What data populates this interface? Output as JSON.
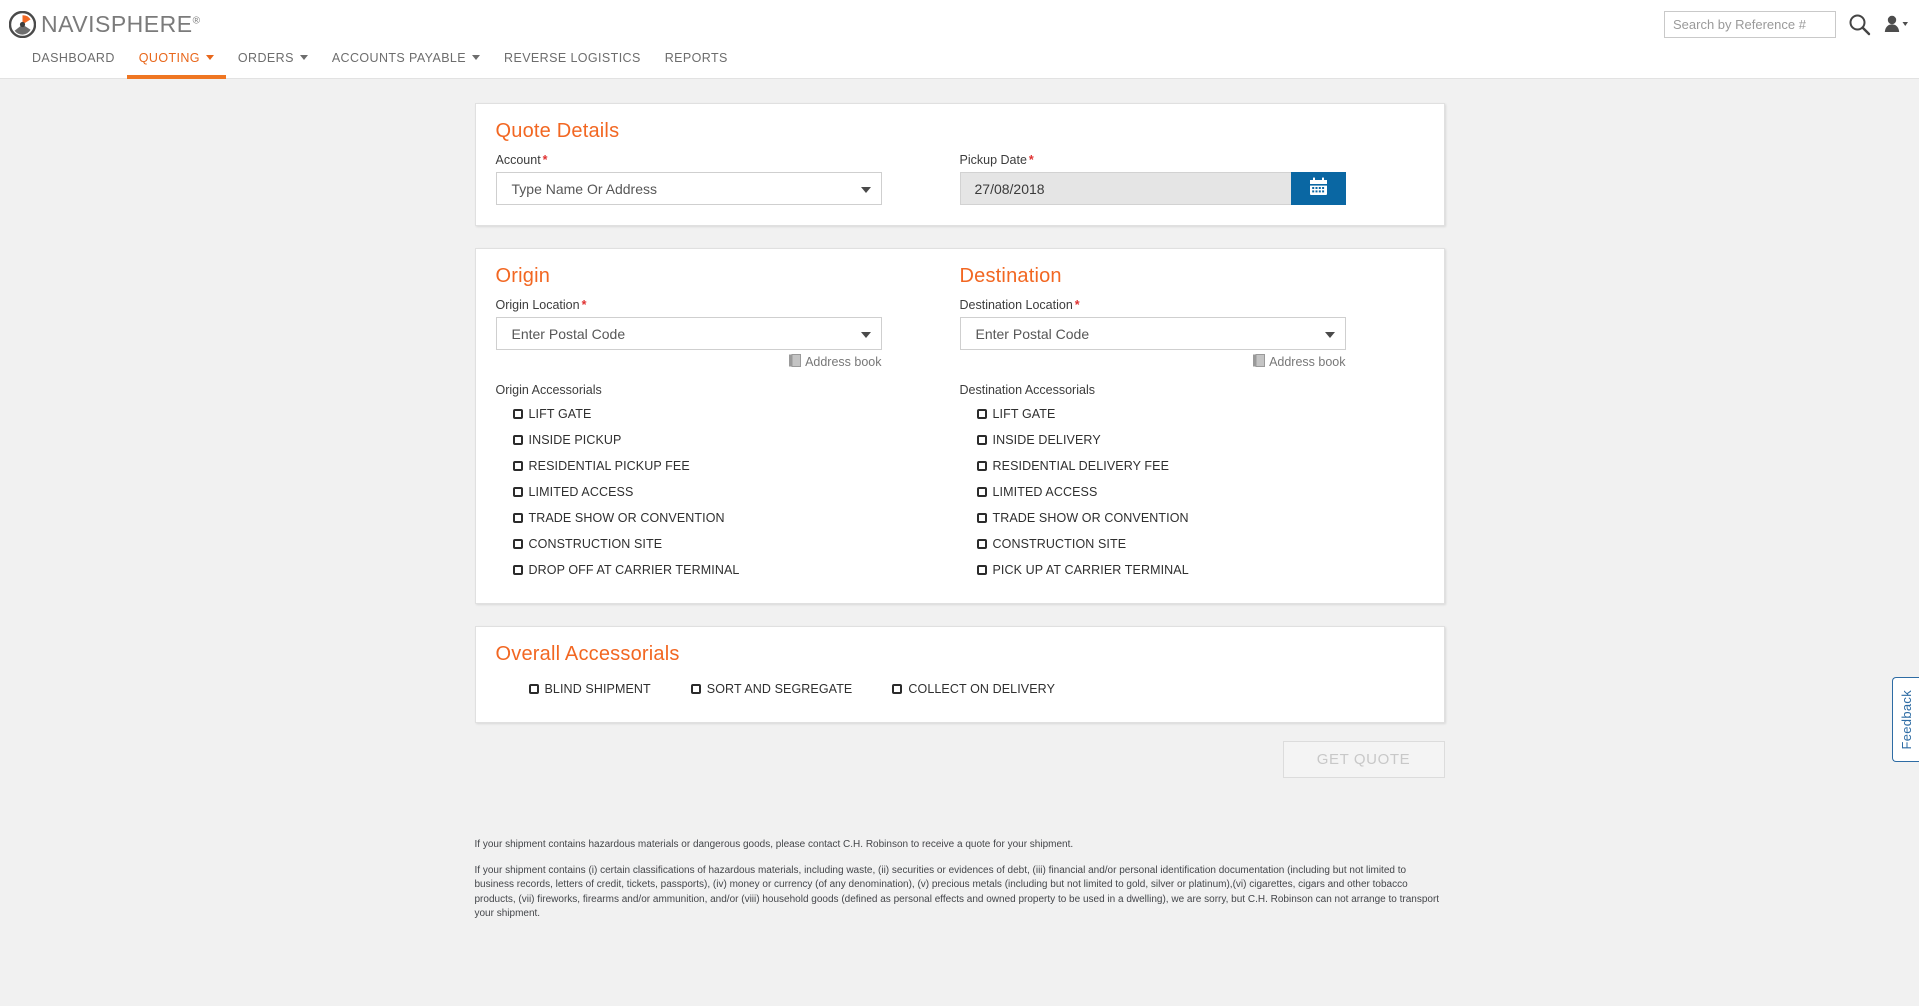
{
  "brand": {
    "logo_text": "NAVISPHERE",
    "logo_reg": "®",
    "accent_color": "#f26722",
    "nav_active_color": "#ef7622",
    "calendar_btn_color": "#0a67a3",
    "required_color": "#e03131"
  },
  "header": {
    "search": {
      "placeholder": "Search by Reference #",
      "value": ""
    },
    "search_icon": "search-icon",
    "user_icon": "user-avatar-icon"
  },
  "nav": {
    "items": [
      {
        "label": "DASHBOARD",
        "active": false,
        "has_caret": false
      },
      {
        "label": "QUOTING",
        "active": true,
        "has_caret": true
      },
      {
        "label": "ORDERS",
        "active": false,
        "has_caret": true
      },
      {
        "label": "ACCOUNTS PAYABLE",
        "active": false,
        "has_caret": true
      },
      {
        "label": "REVERSE LOGISTICS",
        "active": false,
        "has_caret": false
      },
      {
        "label": "REPORTS",
        "active": false,
        "has_caret": false
      }
    ]
  },
  "quote_details": {
    "title": "Quote Details",
    "account": {
      "label": "Account",
      "required": "*",
      "value": "Type Name Or Address"
    },
    "pickup_date": {
      "label": "Pickup Date",
      "required": "*",
      "value": "27/08/2018",
      "button_icon": "calendar-icon"
    }
  },
  "origin": {
    "title": "Origin",
    "location": {
      "label": "Origin Location",
      "required": "*",
      "value": "Enter Postal Code"
    },
    "address_book": "Address book",
    "accessorials_label": "Origin Accessorials",
    "accessorials": [
      "LIFT GATE",
      "INSIDE PICKUP",
      "RESIDENTIAL PICKUP FEE",
      "LIMITED ACCESS",
      "TRADE SHOW OR CONVENTION",
      "CONSTRUCTION SITE",
      "DROP OFF AT CARRIER TERMINAL"
    ]
  },
  "destination": {
    "title": "Destination",
    "location": {
      "label": "Destination Location",
      "required": "*",
      "value": "Enter Postal Code"
    },
    "address_book": "Address book",
    "accessorials_label": "Destination Accessorials",
    "accessorials": [
      "LIFT GATE",
      "INSIDE DELIVERY",
      "RESIDENTIAL DELIVERY FEE",
      "LIMITED ACCESS",
      "TRADE SHOW OR CONVENTION",
      "CONSTRUCTION SITE",
      "PICK UP AT CARRIER TERMINAL"
    ]
  },
  "overall": {
    "title": "Overall Accessorials",
    "accessorials": [
      "BLIND SHIPMENT",
      "SORT AND SEGREGATE",
      "COLLECT ON DELIVERY"
    ]
  },
  "actions": {
    "get_quote": "GET QUOTE"
  },
  "footer": {
    "paragraph1": "If your shipment contains hazardous materials or dangerous goods, please contact C.H. Robinson to receive a quote for your shipment.",
    "paragraph2": "If your shipment contains (i) certain classifications of hazardous materials, including waste, (ii) securities or evidences of debt, (iii) financial and/or personal identification documentation (including but not limited to business records, letters of credit, tickets, passports), (iv) money or currency (of any denomination), (v) precious metals (including but not limited to gold, silver or platinum),(vi) cigarettes, cigars and other tobacco products, (vii) fireworks, firearms and/or ammunition, and/or (viii) household goods (defined as personal effects and owned property to be used in a dwelling), we are sorry, but C.H. Robinson can not arrange to transport your shipment."
  },
  "feedback": {
    "label": "Feedback"
  }
}
